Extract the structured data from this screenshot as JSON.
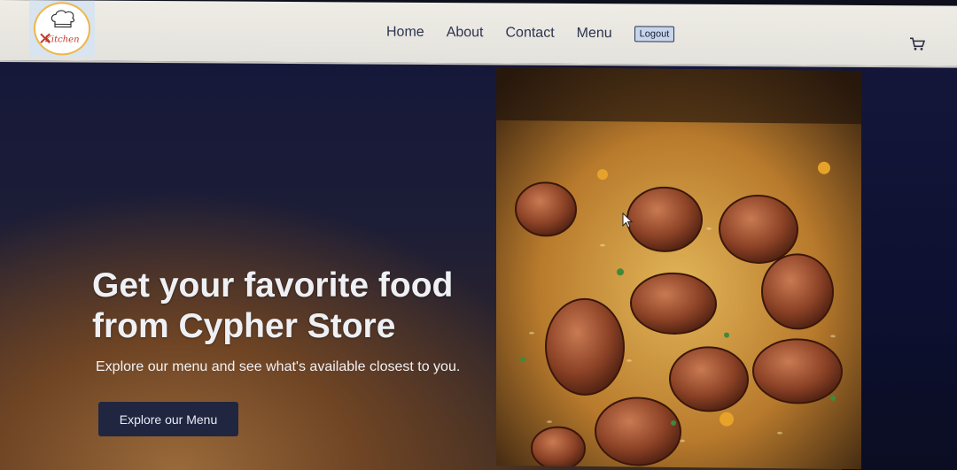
{
  "brand": {
    "logo_text": "Kitchen"
  },
  "nav": {
    "links": [
      "Home",
      "About",
      "Contact",
      "Menu"
    ],
    "logout_label": "Logout",
    "cart_icon": "cart-icon"
  },
  "hero": {
    "headline": "Get your favorite food from Cypher Store",
    "subtext": "Explore our menu and see what's available closest to you.",
    "cta_label": "Explore our Menu",
    "image_alt": "sausage-and-rice-dish"
  },
  "colors": {
    "navbar_bg": "#e8e6e0",
    "hero_dark": "#15183a",
    "hero_warm": "#9a6a3a",
    "button_bg": "#202640",
    "logout_bg": "#c7d5ea"
  }
}
